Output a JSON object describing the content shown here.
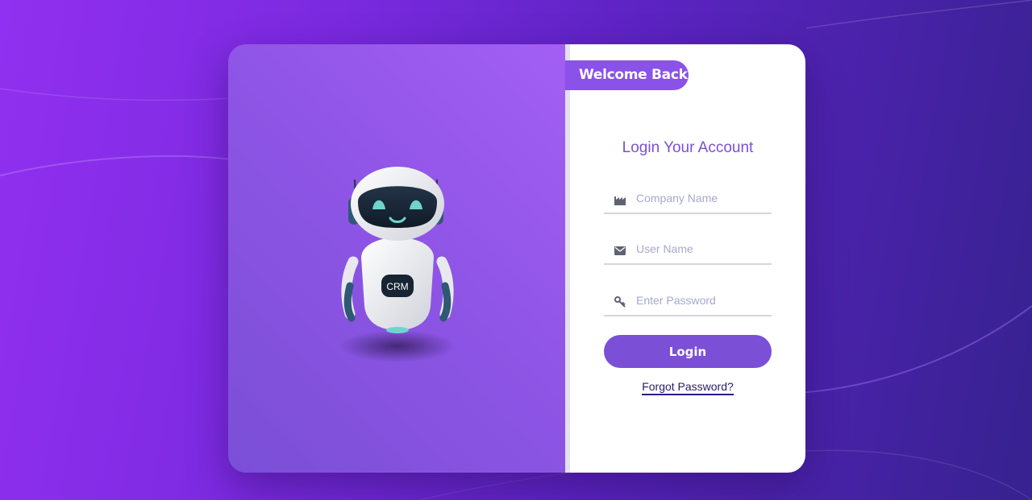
{
  "welcome_badge": "Welcome Back",
  "form": {
    "title": "Login Your Account",
    "company_placeholder": "Company Name",
    "username_placeholder": "User Name",
    "password_placeholder": "Enter Password",
    "login_label": "Login",
    "forgot_label": "Forgot Password?"
  },
  "robot": {
    "chest_label": "CRM"
  },
  "icons": {
    "company": "factory-icon",
    "username": "envelope-icon",
    "password": "key-icon"
  },
  "colors": {
    "accent": "#7b4fd6",
    "badge": "#8a52e8",
    "placeholder": "#a5a9cc",
    "link": "#2a1a6e"
  }
}
